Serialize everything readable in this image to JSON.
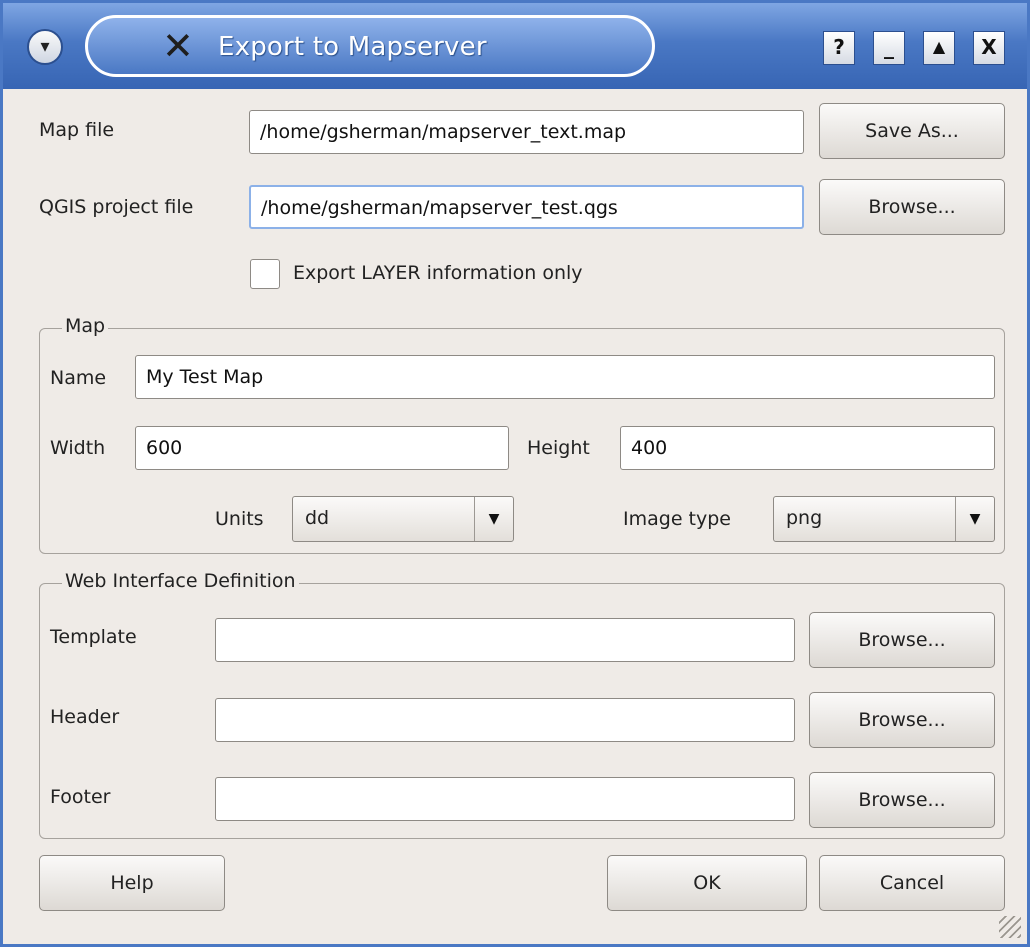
{
  "window": {
    "title": "Export to Mapserver"
  },
  "titlebar_buttons": {
    "help": "?",
    "minimize": "_",
    "shade": "▲",
    "close": "X"
  },
  "map_file": {
    "label": "Map file",
    "value": "/home/gsherman/mapserver_text.map",
    "button": "Save As..."
  },
  "project_file": {
    "label": "QGIS project file",
    "value": "/home/gsherman/mapserver_test.qgs",
    "button": "Browse..."
  },
  "export_layer": {
    "label": "Export LAYER information only",
    "checked": false
  },
  "map_group": {
    "title": "Map",
    "name_label": "Name",
    "name_value": "My Test Map",
    "width_label": "Width",
    "width_value": "600",
    "height_label": "Height",
    "height_value": "400",
    "units_label": "Units",
    "units_value": "dd",
    "image_type_label": "Image type",
    "image_type_value": "png"
  },
  "web_group": {
    "title": "Web Interface Definition",
    "template_label": "Template",
    "template_value": "",
    "template_button": "Browse...",
    "header_label": "Header",
    "header_value": "",
    "header_button": "Browse...",
    "footer_label": "Footer",
    "footer_value": "",
    "footer_button": "Browse..."
  },
  "footer_buttons": {
    "help": "Help",
    "ok": "OK",
    "cancel": "Cancel"
  },
  "colors": {
    "titlebar": "#4a78c4",
    "dialog_bg": "#efebe7",
    "focus": "#8cb1e8"
  }
}
